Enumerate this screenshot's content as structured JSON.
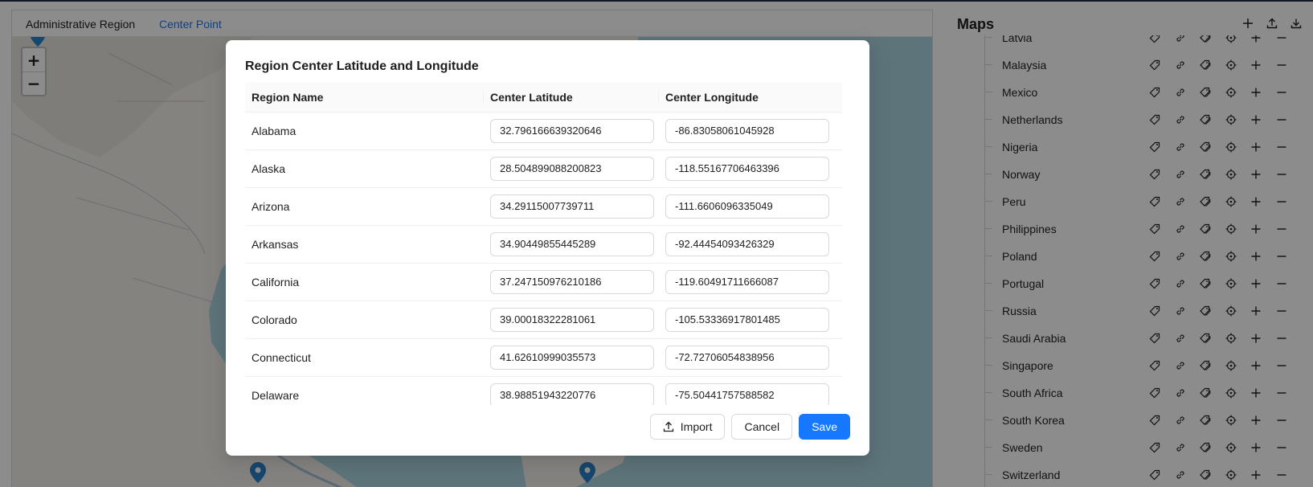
{
  "map": {
    "tabs": [
      {
        "label": "Administrative Region",
        "active": false
      },
      {
        "label": "Center Point",
        "active": true
      }
    ],
    "zoom_in": "+",
    "zoom_out": "−"
  },
  "sidebar": {
    "title": "Maps",
    "countries": [
      {
        "label": "Latvia"
      },
      {
        "label": "Malaysia"
      },
      {
        "label": "Mexico"
      },
      {
        "label": "Netherlands"
      },
      {
        "label": "Nigeria"
      },
      {
        "label": "Norway"
      },
      {
        "label": "Peru"
      },
      {
        "label": "Philippines"
      },
      {
        "label": "Poland"
      },
      {
        "label": "Portugal"
      },
      {
        "label": "Russia"
      },
      {
        "label": "Saudi Arabia"
      },
      {
        "label": "Singapore"
      },
      {
        "label": "South Africa"
      },
      {
        "label": "South Korea"
      },
      {
        "label": "Sweden"
      },
      {
        "label": "Switzerland"
      }
    ]
  },
  "modal": {
    "title": "Region Center Latitude and Longitude",
    "columns": [
      "Region Name",
      "Center Latitude",
      "Center Longitude"
    ],
    "rows": [
      {
        "name": "Alabama",
        "lat": "32.796166639320646",
        "lng": "-86.83058061045928"
      },
      {
        "name": "Alaska",
        "lat": "28.504899088200823",
        "lng": "-118.55167706463396"
      },
      {
        "name": "Arizona",
        "lat": "34.29115007739711",
        "lng": "-111.6606096335049"
      },
      {
        "name": "Arkansas",
        "lat": "34.90449855445289",
        "lng": "-92.44454093426329"
      },
      {
        "name": "California",
        "lat": "37.247150976210186",
        "lng": "-119.60491711666087"
      },
      {
        "name": "Colorado",
        "lat": "39.00018322281061",
        "lng": "-105.53336917801485"
      },
      {
        "name": "Connecticut",
        "lat": "41.62610999035573",
        "lng": "-72.72706054838956"
      },
      {
        "name": "Delaware",
        "lat": "38.98851943220776",
        "lng": "-75.50441757588582"
      }
    ],
    "buttons": {
      "import": "Import",
      "cancel": "Cancel",
      "save": "Save"
    }
  },
  "colors": {
    "primary": "#1677ff",
    "mask": "rgba(0,0,0,0.45)",
    "map_water": "#aad3df",
    "map_land": "#f2efe9"
  }
}
